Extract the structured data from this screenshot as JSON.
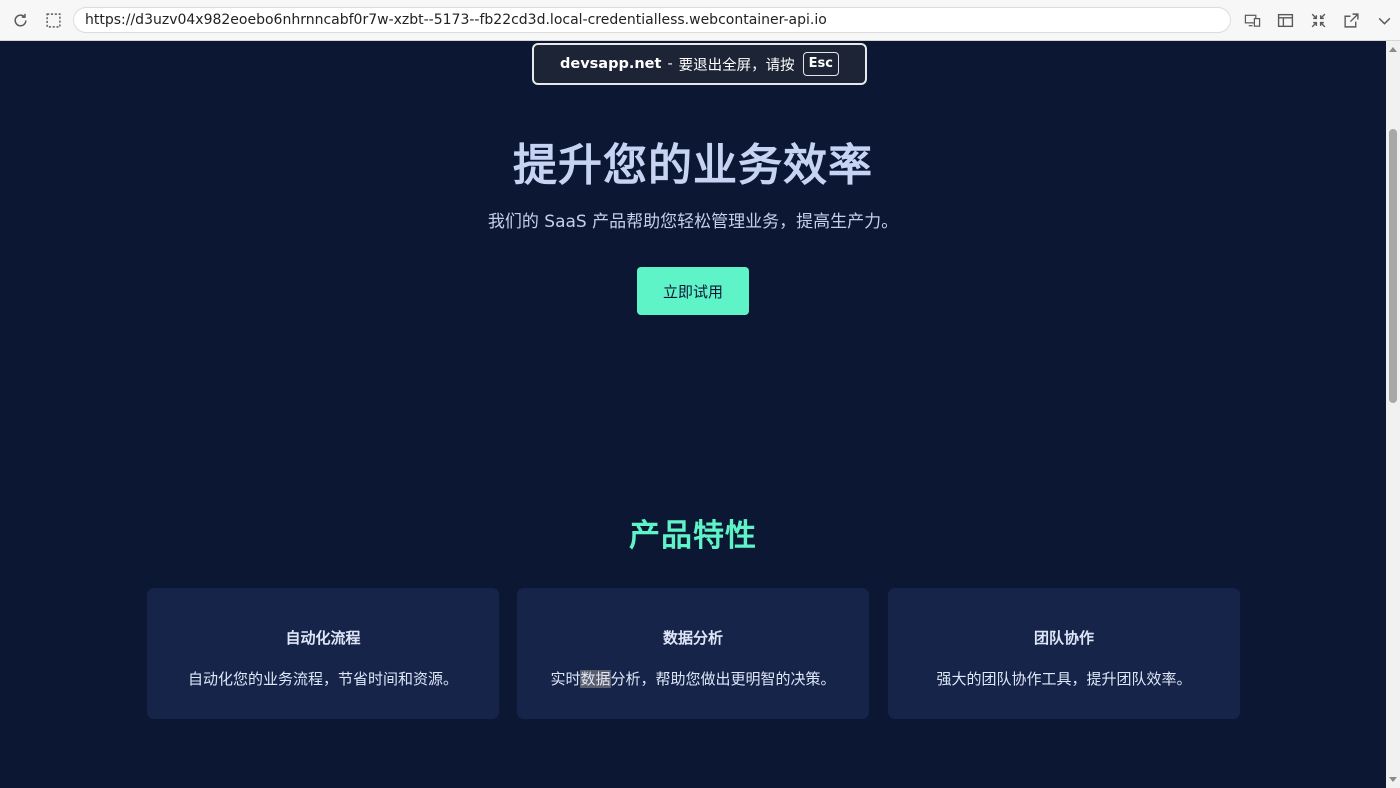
{
  "browser": {
    "url": "https://d3uzv04x982eoebo6nhrnncabf0r7w-xzbt--5173--fb22cd3d.local-credentialless.webcontainer-api.io",
    "left_icons": [
      "reload-icon",
      "screenshot-select-icon"
    ],
    "right_icons": [
      "device-mode-icon",
      "layout-icon",
      "exit-fullscreen-icon",
      "open-new-window-icon",
      "chevron-down-icon"
    ]
  },
  "fullscreen_notice": {
    "domain": "devsapp.net",
    "separator": "-",
    "message": "要退出全屏，请按",
    "key": "Esc"
  },
  "hero": {
    "title": "提升您的业务效率",
    "subtitle": "我们的 SaaS 产品帮助您轻松管理业务，提高生产力。",
    "cta_label": "立即试用"
  },
  "features": {
    "title": "产品特性",
    "cards": [
      {
        "title": "自动化流程",
        "desc": "自动化您的业务流程，节省时间和资源。"
      },
      {
        "title": "数据分析",
        "desc_before": "实时",
        "desc_highlight": "数据",
        "desc_after": "分析，帮助您做出更明智的决策。"
      },
      {
        "title": "团队协作",
        "desc": "强大的团队协作工具，提升团队效率。"
      }
    ]
  },
  "colors": {
    "page_background": "#0c1833",
    "accent": "#5ff3c8",
    "card_background": "#16244a",
    "title_text": "#c7d3f2"
  }
}
